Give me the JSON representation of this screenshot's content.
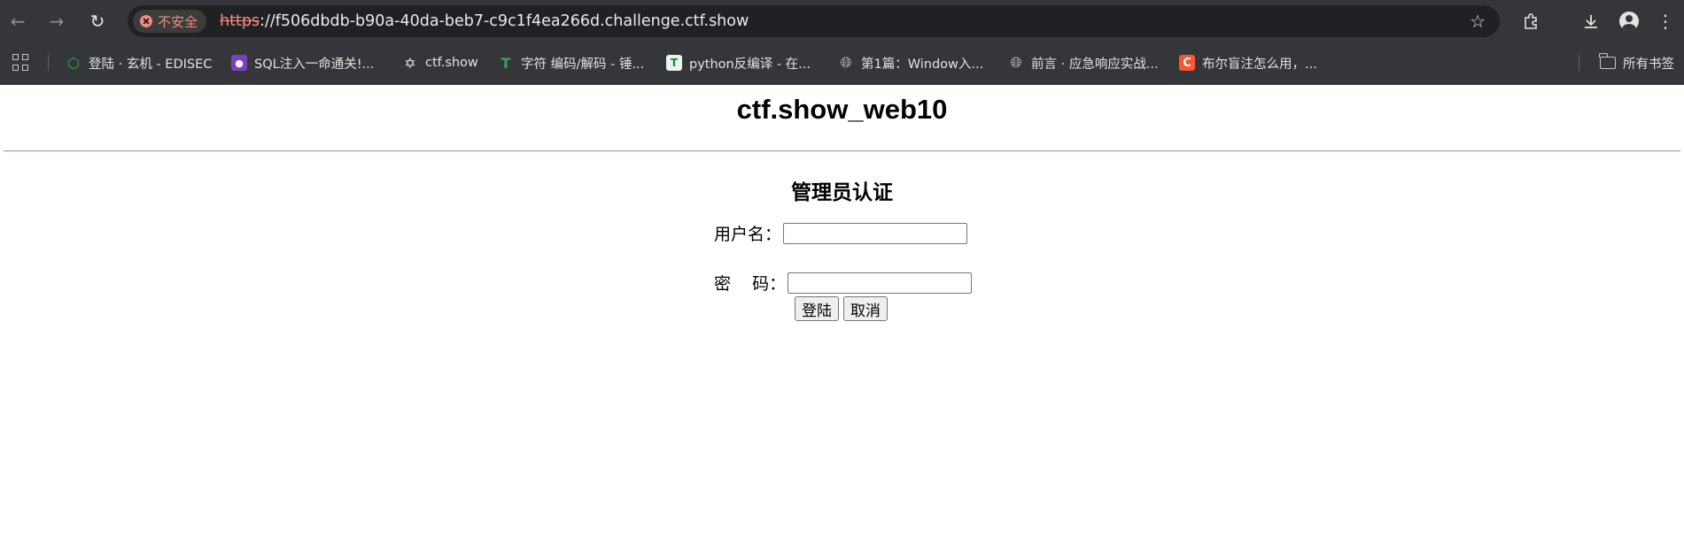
{
  "browser": {
    "security_label": "不安全",
    "url_scheme": "https",
    "url_rest": "://f506dbdb-b90a-40da-beb7-c9c1f4ea266d.challenge.ctf.show",
    "icons": {
      "back": "back-arrow-icon",
      "forward": "forward-arrow-icon",
      "reload": "reload-icon",
      "bookmark_star": "star-icon",
      "extensions": "extensions-icon",
      "downloads": "download-icon",
      "profile": "profile-icon",
      "menu": "kebab-menu-icon"
    },
    "colors": {
      "chrome_bg": "#35363a",
      "omnibox_bg": "#202124",
      "insecure": "#f28b82"
    }
  },
  "bookmarks": {
    "items": [
      {
        "label": "登陆 · 玄机 - EDISEC",
        "icon": "hexagon-icon"
      },
      {
        "label": "SQL注入一命通关!...",
        "icon": "sql-icon"
      },
      {
        "label": "ctf.show",
        "icon": "ctfshow-icon"
      },
      {
        "label": "字符 编码/解码 - 锤...",
        "icon": "t-icon"
      },
      {
        "label": "python反编译 - 在...",
        "icon": "python-decompile-icon"
      },
      {
        "label": "第1篇：Window入...",
        "icon": "globe-icon"
      },
      {
        "label": "前言 · 应急响应实战...",
        "icon": "globe-icon"
      },
      {
        "label": "布尔盲注怎么用，...",
        "icon": "csdn-icon"
      }
    ],
    "all_bookmarks_label": "所有书签"
  },
  "page": {
    "title": "ctf.show_web10",
    "form_heading": "管理员认证",
    "username_label": "用户名：",
    "username_value": "",
    "password_label": "密    码：",
    "password_value": "",
    "login_button": "登陆",
    "cancel_button": "取消"
  }
}
